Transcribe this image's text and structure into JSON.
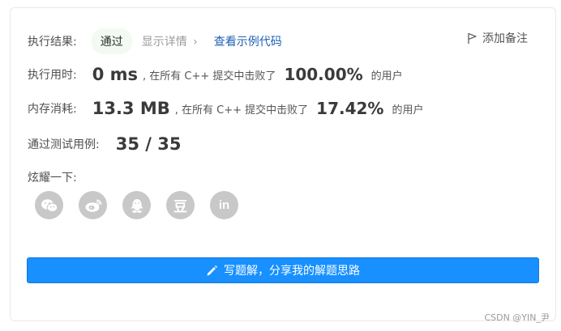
{
  "result": {
    "label": "执行结果:",
    "status": "通过",
    "details_link": "显示详情",
    "details_chevron": "›",
    "example_link": "查看示例代码",
    "add_note": "添加备注"
  },
  "runtime": {
    "label": "执行用时:",
    "value": "0 ms",
    "mid": ", 在所有 C++ 提交中击败了",
    "percent": "100.00%",
    "suffix": "的用户"
  },
  "memory": {
    "label": "内存消耗:",
    "value": "13.3 MB",
    "mid": ", 在所有 C++ 提交中击败了",
    "percent": "17.42%",
    "suffix": "的用户"
  },
  "tests": {
    "label": "通过测试用例:",
    "value": "35 / 35"
  },
  "share": {
    "label": "炫耀一下:",
    "icons": [
      "wechat-icon",
      "weibo-icon",
      "qq-icon",
      "douban-icon",
      "linkedin-icon"
    ],
    "douban_glyph": "豆",
    "linkedin_glyph": "in"
  },
  "write_button": {
    "label": "写题解，分享我的解题思路",
    "icon": "pencil-icon"
  },
  "watermark": "CSDN @YIN_尹",
  "colors": {
    "button": "#1890ff",
    "link": "#1e5fb3",
    "badge_bg": "#f3faf3",
    "icon_gray": "#c8c8c8"
  }
}
